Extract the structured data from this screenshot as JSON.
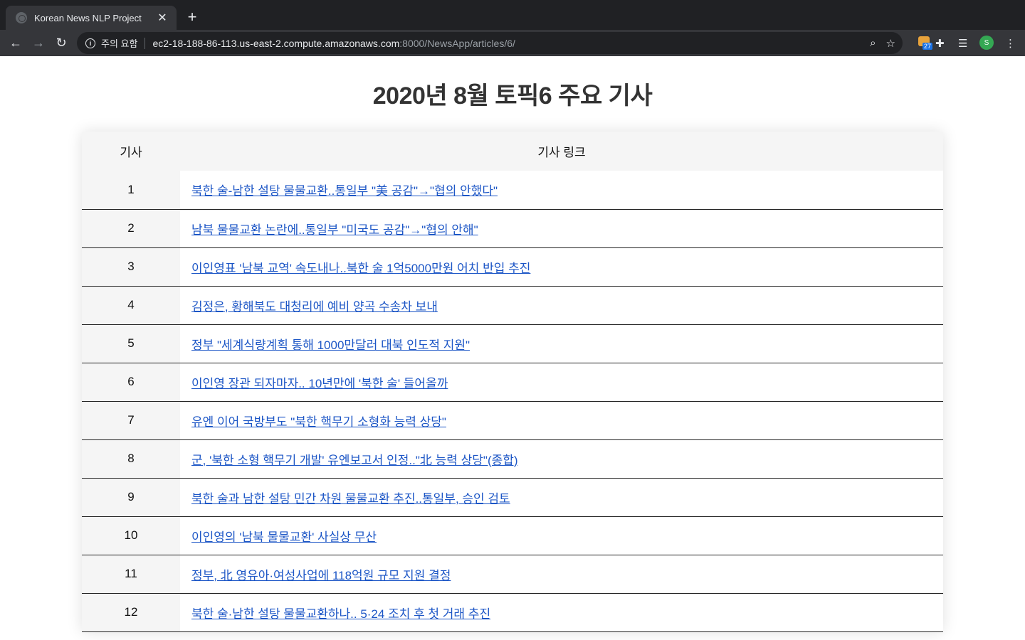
{
  "browser": {
    "tab_title": "Korean News NLP Project",
    "security_label": "주의 요함",
    "url_host": "ec2-18-188-86-113.us-east-2.compute.amazonaws.com",
    "url_path": ":8000/NewsApp/articles/6/",
    "extension_badge_count": "27",
    "profile_initial": "S"
  },
  "page": {
    "title": "2020년 8월 토픽6 주요 기사"
  },
  "table": {
    "headers": [
      "기사",
      "기사 링크"
    ],
    "rows": [
      {
        "num": "1",
        "title": "북한 술-남한 설탕 물물교환..통일부 \"美 공감\"→\"협의 안했다\""
      },
      {
        "num": "2",
        "title": "남북 물물교환 논란에..통일부 \"미국도 공감\"→\"협의 안해\""
      },
      {
        "num": "3",
        "title": "이인영표 '남북 교역' 속도내나..북한 술 1억5000만원 어치 반입 추진"
      },
      {
        "num": "4",
        "title": "김정은, 황해북도 대청리에 예비 양곡 수송차 보내"
      },
      {
        "num": "5",
        "title": "정부 \"세계식량계획 통해 1000만달러 대북 인도적 지원\""
      },
      {
        "num": "6",
        "title": "이인영 장관 되자마자.. 10년만에 '북한 술' 들어올까"
      },
      {
        "num": "7",
        "title": "유엔 이어 국방부도 \"북한 핵무기 소형화 능력 상당\""
      },
      {
        "num": "8",
        "title": "군, '북한 소형 핵무기 개발' 유엔보고서 인정..\"北 능력 상당\"(종합)"
      },
      {
        "num": "9",
        "title": "북한 술과 남한 설탕 민간 차원 물물교환 추진..통일부, 승인 검토"
      },
      {
        "num": "10",
        "title": "이인영의 '남북 물물교환' 사실상 무산"
      },
      {
        "num": "11",
        "title": "정부, 北 영유아·여성사업에 118억원 규모 지원 결정"
      },
      {
        "num": "12",
        "title": "북한 술·남한 설탕 물물교환하나.. 5·24 조치 후 첫 거래 추진"
      }
    ]
  }
}
